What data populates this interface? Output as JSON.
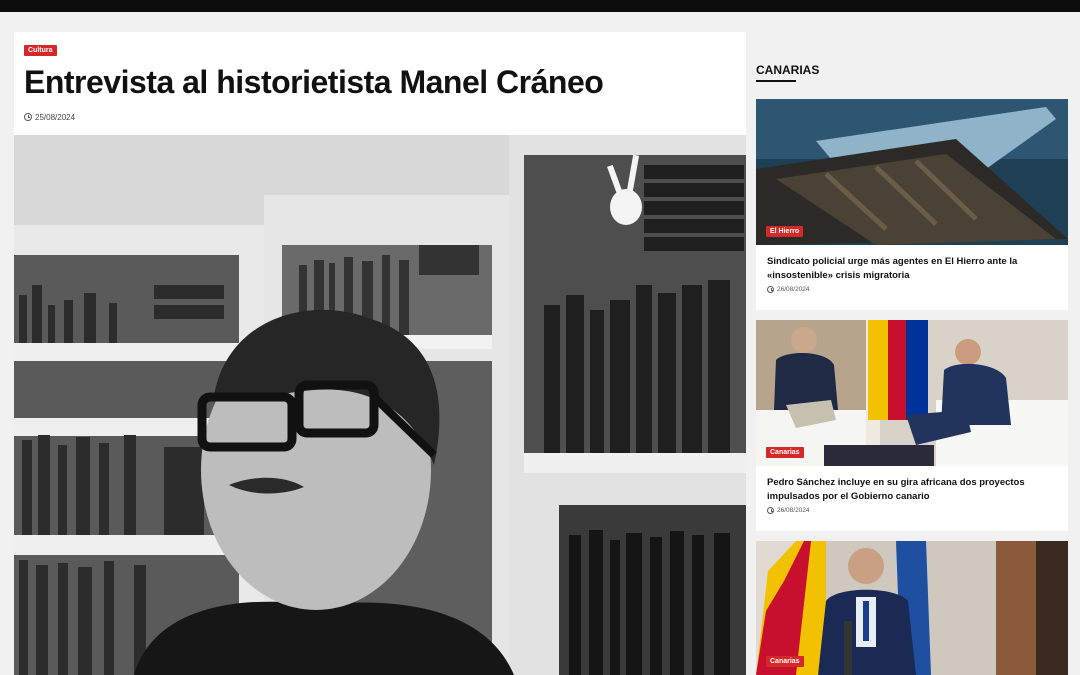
{
  "article": {
    "category": "Cultura",
    "title": "Entrevista al historietista Manel Cráneo",
    "date": "25/08/2024",
    "date_icon": "clock-icon",
    "image_alt": "Portrait photo"
  },
  "sidebar": {
    "section_title": "CANARIAS",
    "cards": [
      {
        "category": "El Hierro",
        "title": "Sindicato policial urge más agentes en El Hierro ante la «insostenible» crisis migratoria",
        "date": "26/08/2024"
      },
      {
        "category": "Canarias",
        "title": "Pedro Sánchez incluye en su gira africana dos proyectos impulsados por el Gobierno canario",
        "date": "26/08/2024"
      },
      {
        "category": "Canarias",
        "title": "",
        "date": ""
      }
    ]
  },
  "colors": {
    "accent": "#d62828",
    "topbar": "#0c0c0c",
    "background": "#f1f1f1"
  }
}
